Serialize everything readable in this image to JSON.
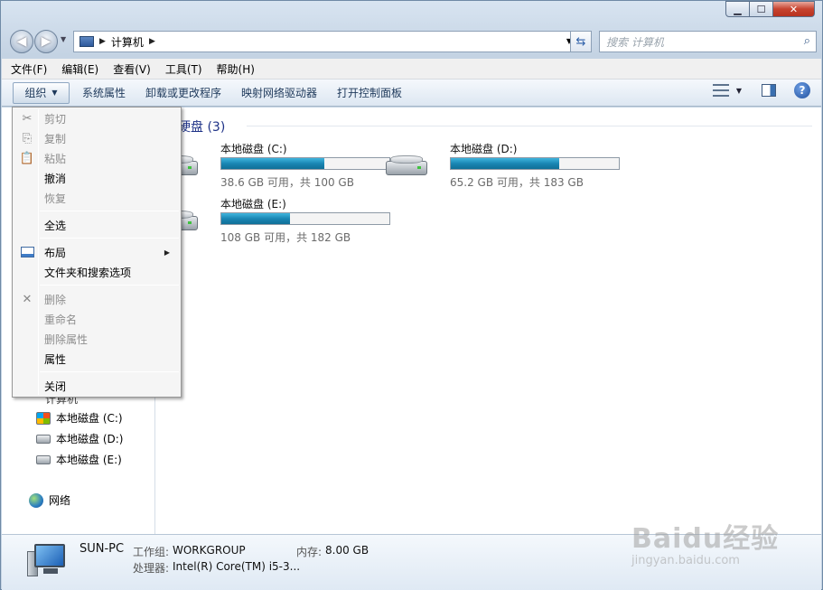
{
  "window": {
    "caption": {
      "minimize": "▁",
      "maximize": "☐",
      "close": "✕"
    }
  },
  "nav": {
    "back": "◀",
    "forward": "▶",
    "address_path": "计算机",
    "search_placeholder": "搜索 计算机"
  },
  "menubar": [
    "文件(F)",
    "编辑(E)",
    "查看(V)",
    "工具(T)",
    "帮助(H)"
  ],
  "toolbar": {
    "organize": "组织",
    "buttons": [
      "系统属性",
      "卸载或更改程序",
      "映射网络驱动器",
      "打开控制面板"
    ],
    "help": "?"
  },
  "main": {
    "group_title": "硬盘 (3)",
    "drives": [
      {
        "name": "本地磁盘 (C:)",
        "free_text": "38.6 GB 可用，共 100 GB",
        "used_fraction": 0.614
      },
      {
        "name": "本地磁盘 (D:)",
        "free_text": "65.2 GB 可用，共 183 GB",
        "used_fraction": 0.644
      },
      {
        "name": "本地磁盘 (E:)",
        "free_text": "108 GB 可用，共 182 GB",
        "used_fraction": 0.407
      }
    ]
  },
  "navpane": {
    "computer_partial": "计算机",
    "items": [
      "本地磁盘 (C:)",
      "本地磁盘 (D:)",
      "本地磁盘 (E:)"
    ],
    "network": "网络"
  },
  "details": {
    "name": "SUN-PC",
    "workgroup_label": "工作组:",
    "workgroup_value": "WORKGROUP",
    "memory_label": "内存:",
    "memory_value": "8.00 GB",
    "cpu_label": "处理器:",
    "cpu_value": "Intel(R) Core(TM) i5-3..."
  },
  "context_menu": {
    "cut": "剪切",
    "copy": "复制",
    "paste": "粘贴",
    "undo": "撤消",
    "redo": "恢复",
    "select_all": "全选",
    "layout": "布局",
    "folder_options": "文件夹和搜索选项",
    "delete": "删除",
    "rename": "重命名",
    "remove_properties": "删除属性",
    "properties": "属性",
    "close": "关闭"
  },
  "watermark": {
    "logo": "Baidu经验",
    "url": "jingyan.baidu.com"
  }
}
